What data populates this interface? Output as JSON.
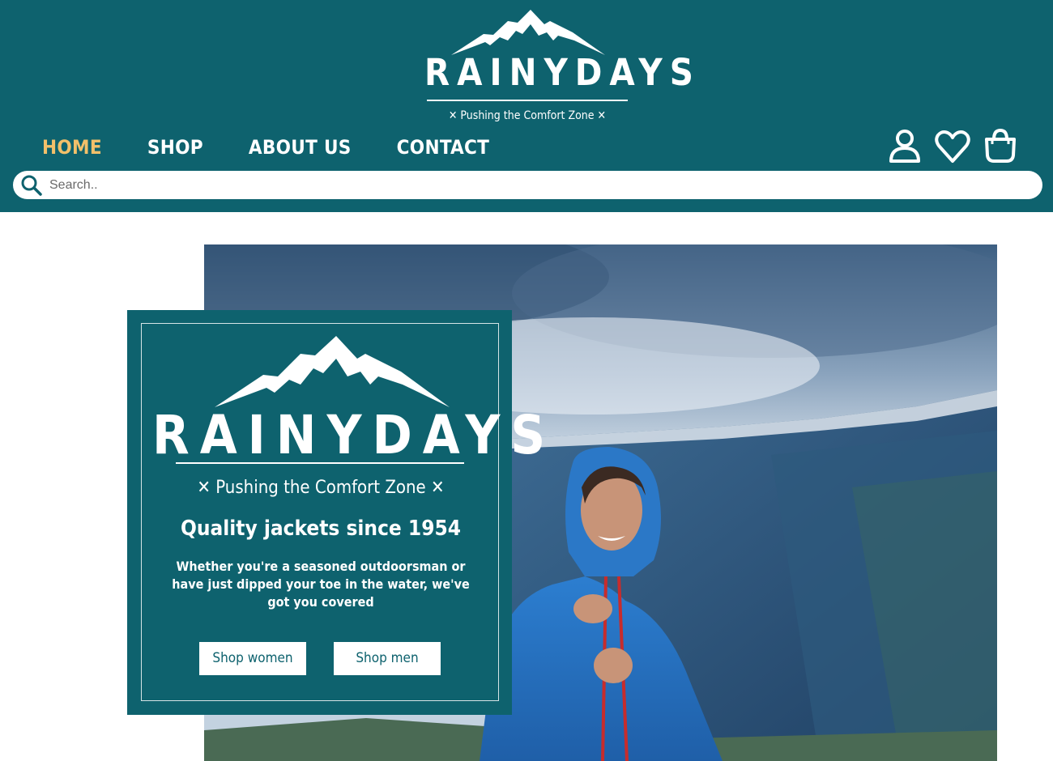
{
  "header": {
    "logo_text": "RAINYDAYS",
    "tagline": "✕ Pushing the Comfort Zone ✕",
    "colors": {
      "background": "#0e626e",
      "active_nav": "#f2c06a",
      "text": "#ffffff"
    }
  },
  "nav": {
    "items": [
      {
        "label": "HOME",
        "active": true
      },
      {
        "label": "SHOP",
        "active": false
      },
      {
        "label": "ABOUT US",
        "active": false
      },
      {
        "label": "CONTACT",
        "active": false
      }
    ]
  },
  "header_icons": [
    "user-icon",
    "heart-icon",
    "shopping-bag-icon"
  ],
  "search": {
    "placeholder": "Search..",
    "value": "",
    "icon": "search-icon"
  },
  "promo": {
    "logo_text": "RAINYDAYS",
    "tagline": "✕ Pushing the Comfort Zone ✕",
    "heading": "Quality jackets since 1954",
    "text": "Whether you're a seasoned outdoorsman or have just dipped your toe in the water, we've got you covered",
    "buttons": {
      "women": "Shop women",
      "men": "Shop men"
    }
  },
  "hero": {
    "image": "woman in blue rain jacket smiling in front of mountain fjord"
  }
}
